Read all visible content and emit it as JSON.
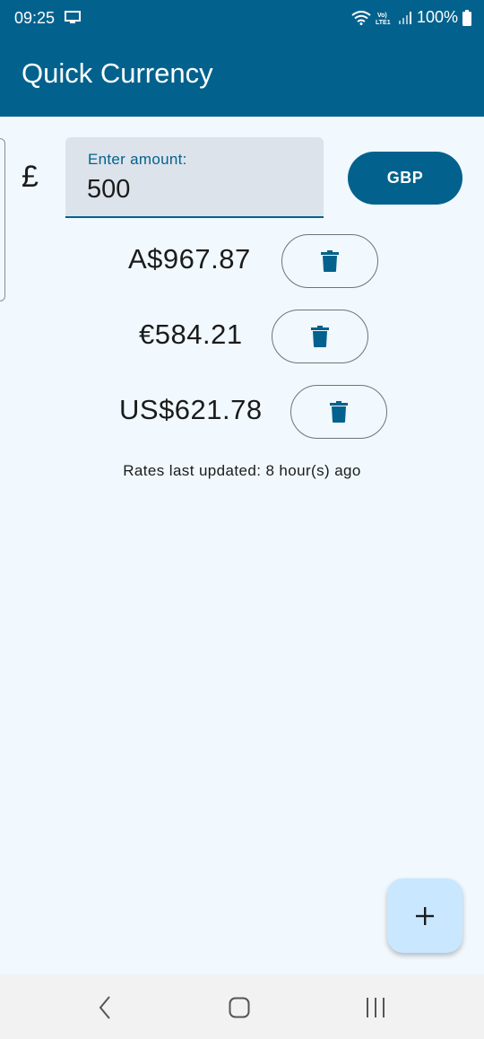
{
  "status_bar": {
    "time": "09:25",
    "battery": "100%",
    "icons": [
      "screen-cast-icon",
      "wifi-icon",
      "volte-icon",
      "signal-icon",
      "battery-icon"
    ]
  },
  "app_bar": {
    "title": "Quick Currency",
    "color": "#03628d"
  },
  "input": {
    "symbol": "£",
    "label": "Enter amount:",
    "value": "500",
    "currency_code": "GBP"
  },
  "conversions": [
    {
      "amount": "A$967.87",
      "delete_icon": "trash-icon"
    },
    {
      "amount": "€584.21",
      "delete_icon": "trash-icon"
    },
    {
      "amount": "US$621.78",
      "delete_icon": "trash-icon"
    }
  ],
  "rates_updated": "Rates last updated: 8 hour(s) ago",
  "fab": {
    "icon": "plus-icon",
    "color": "#c9e7ff"
  },
  "nav": {
    "icons": [
      "back-icon",
      "home-icon",
      "recents-icon"
    ]
  },
  "colors": {
    "accent": "#03628d",
    "background": "#f1f9fe",
    "field": "#dde3ea"
  }
}
